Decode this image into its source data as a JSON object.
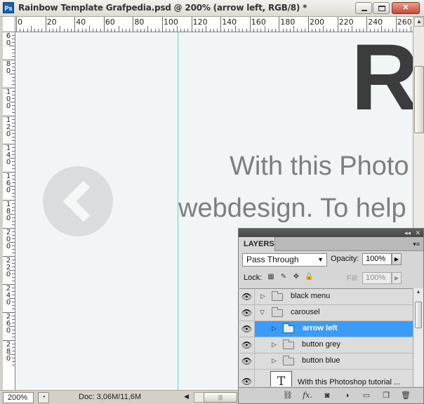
{
  "window": {
    "app_badge": "Ps",
    "title": "Rainbow Template Grafpedia.psd @ 200% (arrow left, RGB/8) *",
    "minimize_icon": "minimize-icon",
    "maximize_icon": "maximize-icon",
    "close_label": "✕"
  },
  "ruler": {
    "horizontal_labels": [
      "0",
      "20",
      "40",
      "60",
      "80",
      "100",
      "120",
      "140",
      "160",
      "180",
      "200",
      "220",
      "240",
      "260"
    ],
    "vertical_labels": [
      "6\n0",
      "8\n0",
      "1\n0\n0",
      "1\n2\n0",
      "1\n4\n0",
      "1\n6\n0",
      "1\n8\n0",
      "2\n0\n0",
      "2\n2\n0",
      "2\n4\n0",
      "2\n6\n0",
      "2\n8\n0"
    ]
  },
  "canvas": {
    "heading_letter": "R",
    "body_line1": "With this Photo",
    "body_line2": "webdesign. To help",
    "arrow_icon": "chevron-left-icon"
  },
  "status": {
    "zoom": "200%",
    "doc_info": "Doc: 3,06M/11,6M",
    "nav_icon": "status-menu-icon"
  },
  "layers_panel": {
    "tab_label": "LAYERS",
    "blend_mode": "Pass Through",
    "opacity_label": "Opacity:",
    "opacity_value": "100%",
    "lock_label": "Lock:",
    "fill_label": "Fill:",
    "fill_value": "100%",
    "layers": [
      {
        "name": "black menu",
        "type": "group",
        "expanded": false,
        "indent": 0,
        "selected": false
      },
      {
        "name": "carousel",
        "type": "group",
        "expanded": true,
        "indent": 0,
        "selected": false
      },
      {
        "name": "arrow left",
        "type": "group",
        "expanded": false,
        "indent": 1,
        "selected": true
      },
      {
        "name": "button grey",
        "type": "group",
        "expanded": false,
        "indent": 1,
        "selected": false
      },
      {
        "name": "button blue",
        "type": "group",
        "expanded": false,
        "indent": 1,
        "selected": false
      },
      {
        "name": "With this Photoshop tutorial ...",
        "type": "text",
        "indent": 0,
        "selected": false
      }
    ],
    "text_thumb": "T",
    "footer_icons": [
      "link-icon",
      "fx-icon",
      "mask-icon",
      "adjustment-icon",
      "folder-icon",
      "new-layer-icon",
      "trash-icon"
    ],
    "footer_fx": "fx."
  },
  "colors": {
    "selection": "#3b9bf9",
    "guide": "#58d4e6",
    "canvas_bg": "#f1f5f6"
  }
}
